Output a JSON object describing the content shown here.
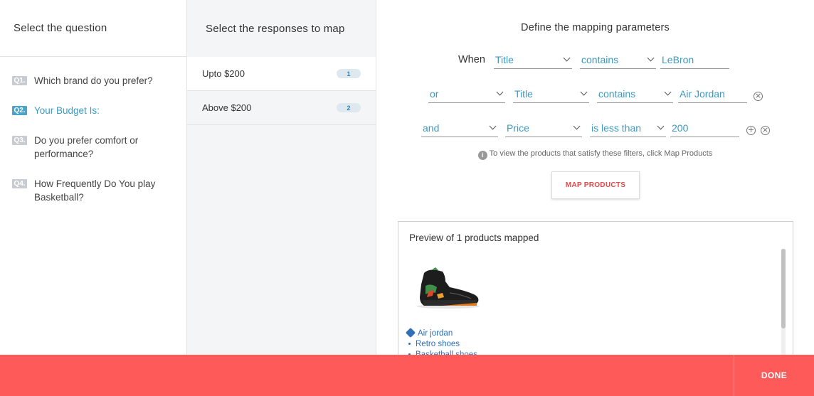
{
  "questions": {
    "header": "Select the question",
    "items": [
      {
        "num": "Q1.",
        "text": "Which brand do you prefer?"
      },
      {
        "num": "Q2.",
        "text": "Your Budget Is:"
      },
      {
        "num": "Q3.",
        "text": "Do you prefer comfort or performance?"
      },
      {
        "num": "Q4.",
        "text": "How Frequently Do You play Basketball?"
      }
    ]
  },
  "responses": {
    "header": "Select the responses to map",
    "items": [
      {
        "label": "Upto $200",
        "count": "1"
      },
      {
        "label": "Above $200",
        "count": "2"
      }
    ]
  },
  "mapping": {
    "header": "Define the mapping parameters",
    "rules": [
      {
        "connector": "When",
        "field": "Title",
        "operator": "contains",
        "value": "LeBron"
      },
      {
        "connector": "or",
        "field": "Title",
        "operator": "contains",
        "value": "Air Jordan"
      },
      {
        "connector": "and",
        "field": "Price",
        "operator": "is less than",
        "value": "200"
      }
    ],
    "hint": "To view the products that satisfy these filters, click Map Products",
    "map_button": "MAP PRODUCTS",
    "add_symbol": "+",
    "remove_symbol": "×"
  },
  "preview": {
    "title": "Preview of 1 products mapped",
    "product": {
      "tag": "Air jordan",
      "attributes": [
        "Retro shoes",
        "Basketball shoes"
      ]
    }
  },
  "footer": {
    "done_label": "DONE"
  }
}
